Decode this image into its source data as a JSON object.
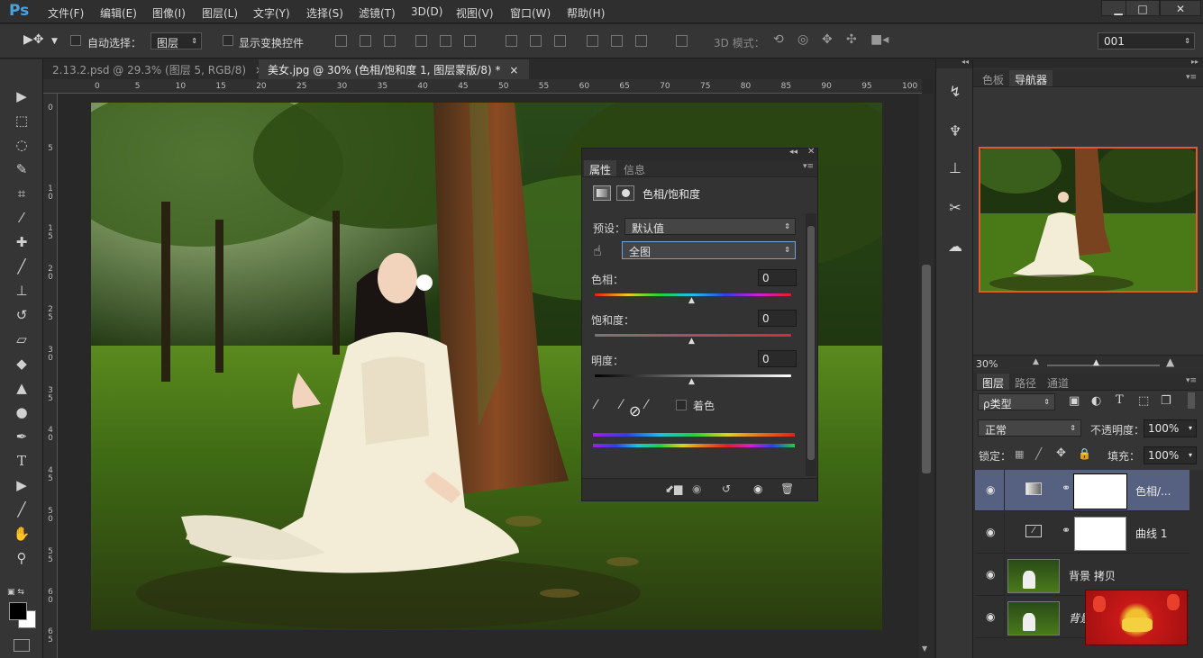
{
  "app": {
    "logo": "Ps",
    "window_buttons": [
      "▁",
      "□",
      "✕"
    ]
  },
  "menu": [
    "文件(F)",
    "编辑(E)",
    "图像(I)",
    "图层(L)",
    "文字(Y)",
    "选择(S)",
    "滤镜(T)",
    "3D(D)",
    "视图(V)",
    "窗口(W)",
    "帮助(H)"
  ],
  "options": {
    "auto_select_label": "自动选择：",
    "auto_select_value": "图层",
    "show_transform_label": "显示变换控件",
    "mode3d_label": "3D 模式：",
    "preset_value": "001"
  },
  "tabs": [
    {
      "label": "2.13.2.psd @ 29.3% (图层 5, RGB/8)",
      "close": "×"
    },
    {
      "label": "美女.jpg @ 30% (色相/饱和度 1, 图层蒙版/8) *",
      "close": "×"
    }
  ],
  "ruler_h": [
    "0",
    "5",
    "10",
    "15",
    "20",
    "25",
    "30",
    "35",
    "40",
    "45",
    "50",
    "55",
    "60",
    "65",
    "70",
    "75",
    "80",
    "85",
    "90",
    "95",
    "100"
  ],
  "ruler_v": [
    "0",
    "5",
    "1 0",
    "1 5",
    "2 0",
    "2 5",
    "3 0",
    "3 5",
    "4 0",
    "4 5",
    "5 0",
    "5 5",
    "6 0",
    "6 5"
  ],
  "props": {
    "tab_props": "属性",
    "tab_info": "信息",
    "title": "色相/饱和度",
    "preset_label": "预设：",
    "preset_value": "默认值",
    "channel_value": "全图",
    "hue_label": "色相：",
    "hue_value": "0",
    "sat_label": "饱和度：",
    "sat_value": "0",
    "light_label": "明度：",
    "light_value": "0",
    "colorize_label": "着色"
  },
  "right": {
    "tab_swatches": "色板",
    "tab_navigator": "导航器",
    "zoom": "30%",
    "tab_layers": "图层",
    "tab_paths": "路径",
    "tab_channels": "通道",
    "filter_kind": "ρ类型",
    "blend_mode": "正常",
    "opacity_label": "不透明度：",
    "opacity_value": "100%",
    "lock_label": "锁定：",
    "fill_label": "填充：",
    "fill_value": "100%",
    "layers": [
      {
        "name": "色相/..."
      },
      {
        "name": "曲线 1"
      },
      {
        "name": "背景 拷贝"
      },
      {
        "name": "背景"
      }
    ]
  },
  "colors": {
    "accent": "#4aa3e0",
    "selected_layer": "#566080",
    "nav_frame": "#e05a2a"
  }
}
